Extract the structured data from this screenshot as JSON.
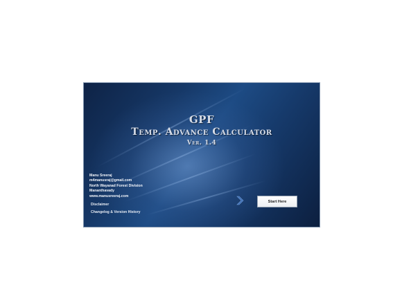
{
  "title": {
    "line1": "GPF",
    "line2": "Temp. Advance Calculator",
    "line3": "Ver. 1.4"
  },
  "author": {
    "name": "Manu Sreeraj",
    "email": "m4manusraj@gmail.com",
    "division": "North Wayanad Forest Division",
    "location": "Mananthavady",
    "website": "www.manusreeraj.com"
  },
  "links": {
    "disclaimer": "Disclaimer",
    "changelog": "Changelog & Version History"
  },
  "start_button": {
    "label": "Start Here"
  },
  "icons": {
    "arrow": "chevron-right-icon"
  },
  "colors": {
    "background_dark": "#0e2346",
    "background_mid": "#1d4b84",
    "title_text": "#d7dde8",
    "arrow": "#3f6fb5"
  }
}
